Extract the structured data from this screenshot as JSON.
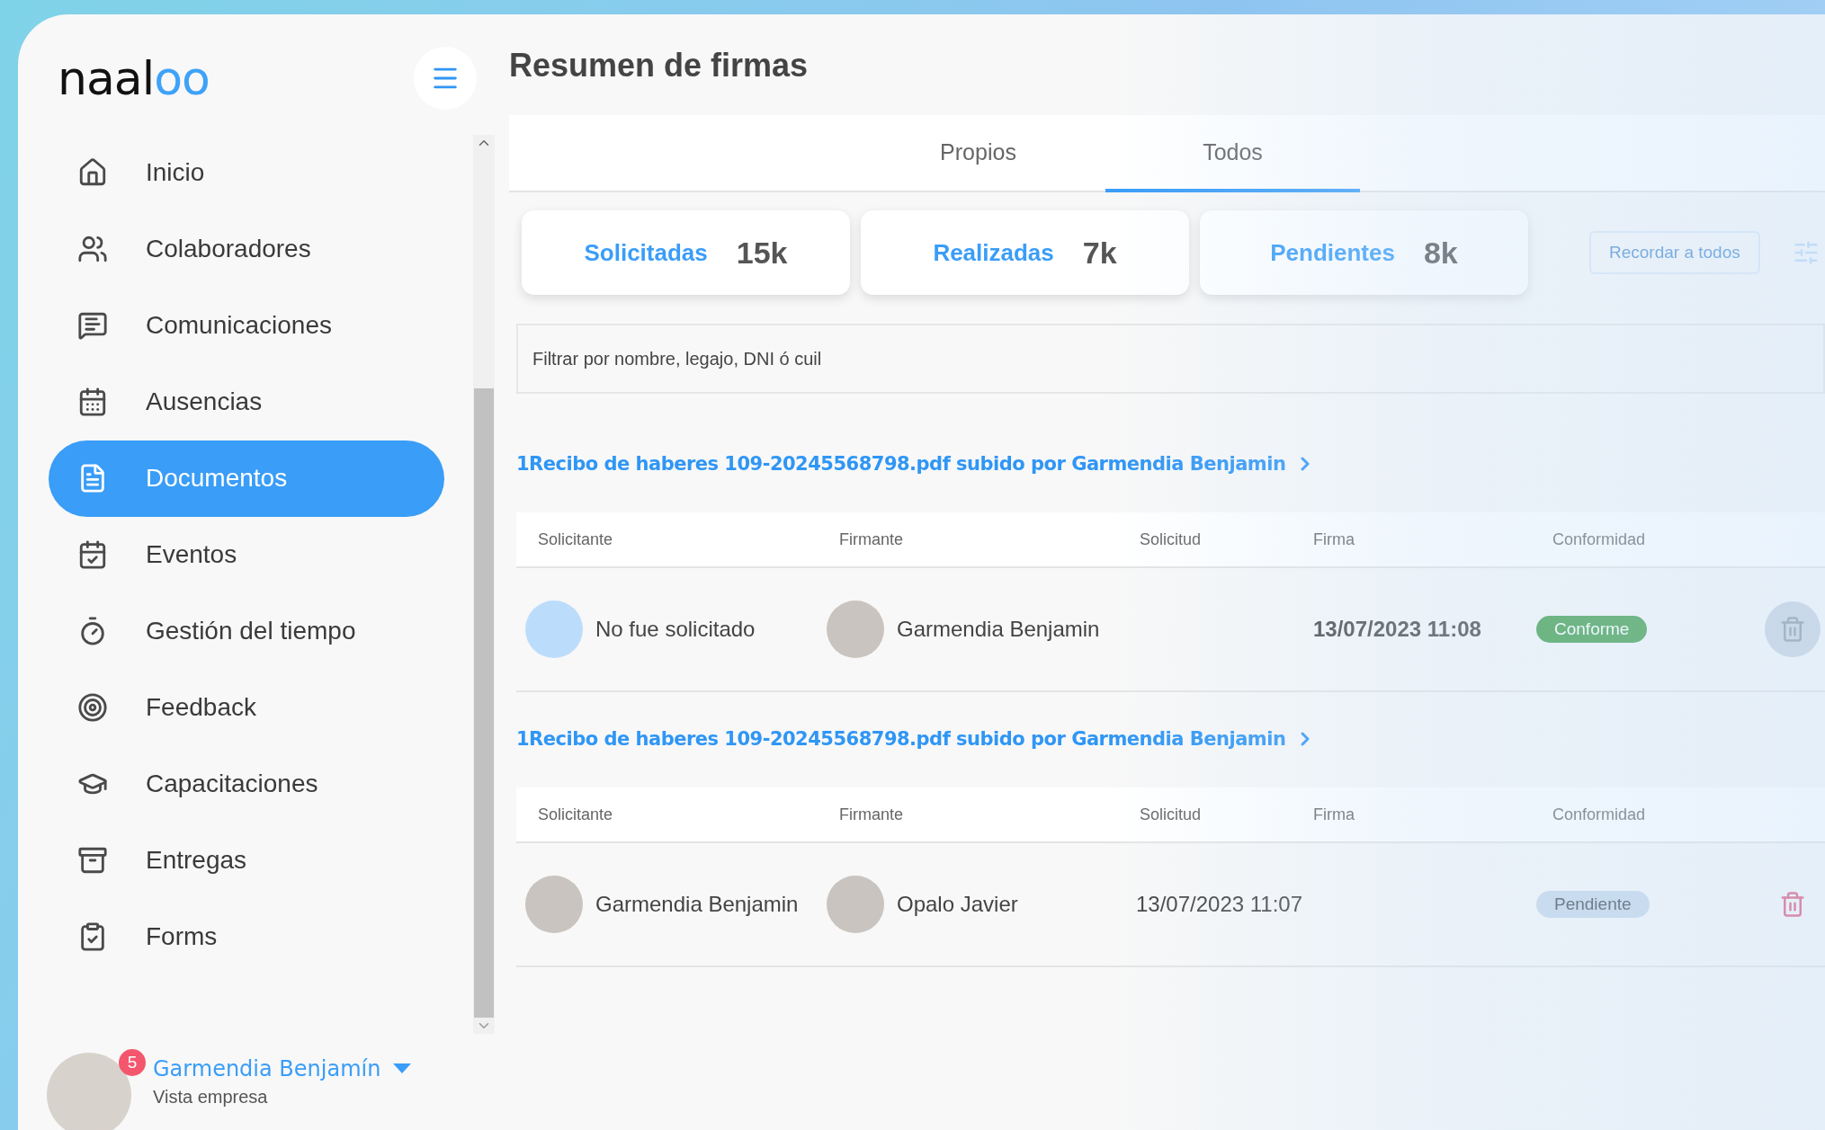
{
  "logo": {
    "dark": "naal",
    "accent": "oo"
  },
  "sidebar": {
    "items": [
      {
        "label": "Inicio",
        "selected": false
      },
      {
        "label": "Colaboradores",
        "selected": false
      },
      {
        "label": "Comunicaciones",
        "selected": false
      },
      {
        "label": "Ausencias",
        "selected": false
      },
      {
        "label": "Documentos",
        "selected": true
      },
      {
        "label": "Eventos",
        "selected": false
      },
      {
        "label": "Gestión del tiempo",
        "selected": false
      },
      {
        "label": "Feedback",
        "selected": false
      },
      {
        "label": "Capacitaciones",
        "selected": false
      },
      {
        "label": "Entregas",
        "selected": false
      },
      {
        "label": "Forms",
        "selected": false
      }
    ]
  },
  "user": {
    "name": "Garmendia Benjamín",
    "subtitle": "Vista empresa",
    "badge": "5"
  },
  "title": "Resumen de firmas",
  "tabs": [
    {
      "label": "Propios",
      "selected": false
    },
    {
      "label": "Todos",
      "selected": true
    }
  ],
  "stats": [
    {
      "label": "Solicitadas",
      "value": "15k"
    },
    {
      "label": "Realizadas",
      "value": "7k"
    },
    {
      "label": "Pendientes",
      "value": "8k"
    }
  ],
  "remind_button": "Recordar a todos",
  "search": {
    "placeholder": "Filtrar por nombre, legajo, DNI ó cuil"
  },
  "documents": [
    {
      "link": "1Recibo de haberes 109-20245568798.pdf subido por Garmendia Benjamin",
      "columns": [
        "Solicitante",
        "Firmante",
        "Solicitud",
        "Firma",
        "Conformidad"
      ],
      "row": {
        "requester": "No fue solicitado",
        "requester_photo": false,
        "signer": "Garmendia Benjamin",
        "signed": "13/07/2023 11:08",
        "status": "Conforme",
        "approved": true,
        "delete_enabled": false
      }
    },
    {
      "link": "1Recibo de haberes 109-20245568798.pdf subido por Garmendia Benjamin",
      "columns": [
        "Solicitante",
        "Firmante",
        "Solicitud",
        "Firma",
        "Conformidad"
      ],
      "row": {
        "requester": "Garmendia Benjamin",
        "requester_photo": true,
        "signer": "Opalo Javier",
        "requested": "13/07/2023 11:07",
        "status": "Pendiente",
        "approved": false,
        "delete_enabled": true
      }
    }
  ]
}
